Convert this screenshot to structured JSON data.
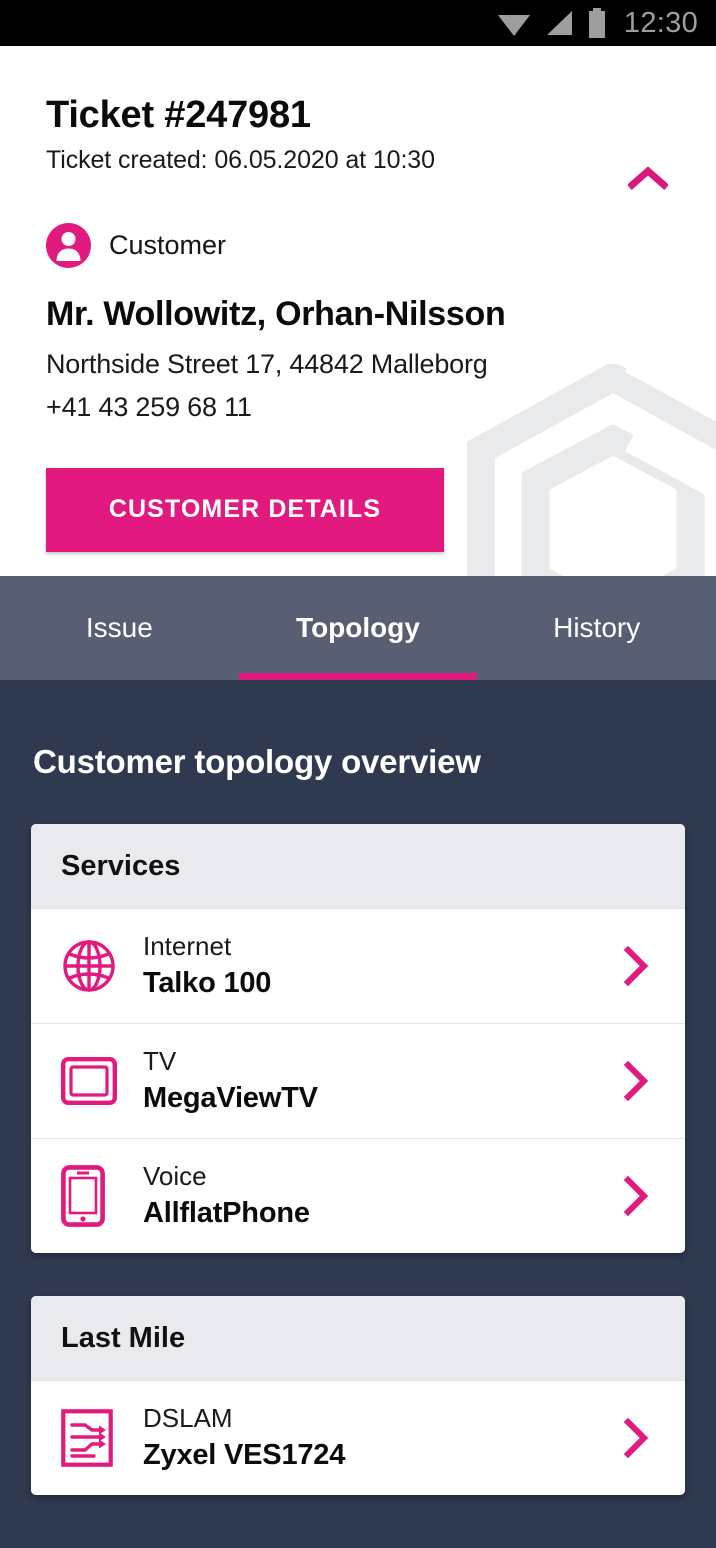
{
  "status_bar": {
    "time": "12:30",
    "icons": [
      "wifi-icon",
      "cellular-signal-icon",
      "battery-icon"
    ]
  },
  "ticket": {
    "title": "Ticket #247981",
    "created_line": "Ticket created:  06.05.2020 at 10:30",
    "collapse_icon": "chevron-up-icon"
  },
  "customer": {
    "role_icon": "person-icon",
    "role_label": "Customer",
    "name": "Mr. Wollowitz, Orhan-Nilsson",
    "address": "Northside Street 17, 44842 Malleborg",
    "phone": "+41 43 259 68 11",
    "details_button": "CUSTOMER DETAILS"
  },
  "tabs": [
    {
      "label": "Issue",
      "active": false
    },
    {
      "label": "Topology",
      "active": true
    },
    {
      "label": "History",
      "active": false
    }
  ],
  "main": {
    "heading": "Customer topology overview",
    "cards": [
      {
        "header": "Services",
        "rows": [
          {
            "icon": "globe-icon",
            "label": "Internet",
            "value": "Talko 100",
            "chevron": "chevron-right-icon"
          },
          {
            "icon": "tv-icon",
            "label": "TV",
            "value": "MegaViewTV",
            "chevron": "chevron-right-icon"
          },
          {
            "icon": "smartphone-icon",
            "label": "Voice",
            "value": "AllflatPhone",
            "chevron": "chevron-right-icon"
          }
        ]
      },
      {
        "header": "Last Mile",
        "rows": [
          {
            "icon": "dslam-icon",
            "label": "DSLAM",
            "value": "Zyxel VES1724",
            "chevron": "chevron-right-icon"
          }
        ]
      }
    ]
  },
  "colors": {
    "accent": "#e2197f",
    "content_bg": "#2f394f",
    "tabbar_bg": "#585f73",
    "card_header_bg": "#e9eaef",
    "status_bar_bg": "#000000",
    "watermark": "#e9eaec"
  }
}
